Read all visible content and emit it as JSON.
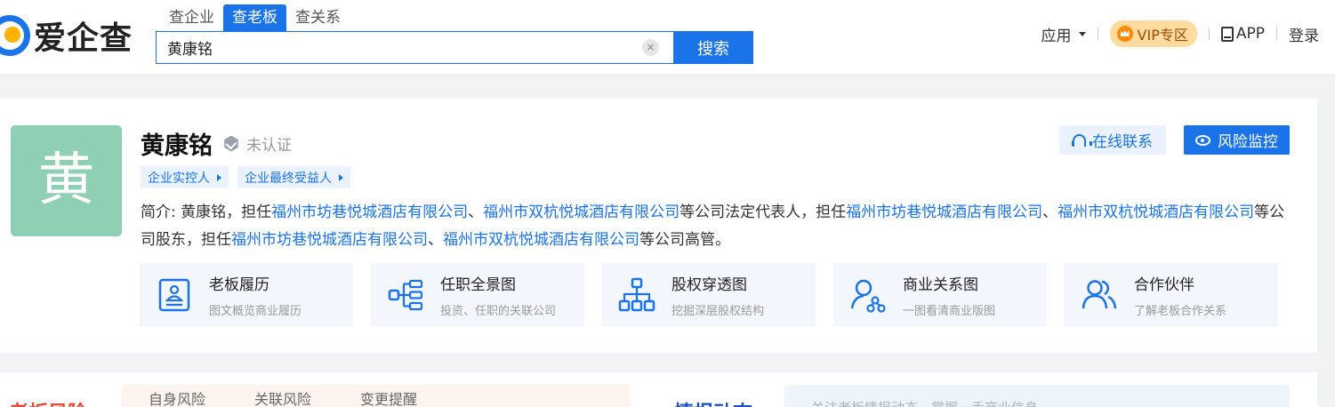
{
  "header": {
    "logo_text": "爱企查",
    "tabs": [
      {
        "label": "查企业",
        "active": false
      },
      {
        "label": "查老板",
        "active": true
      },
      {
        "label": "查关系",
        "active": false
      }
    ],
    "search_value": "黄康铭",
    "search_button": "搜索",
    "clear_glyph": "×",
    "nav": {
      "apps": "应用",
      "vip": "VIP专区",
      "app": "APP",
      "login": "登录"
    }
  },
  "profile": {
    "avatar_char": "黄",
    "name": "黄康铭",
    "verify_status": "未认证",
    "tags": [
      "企业实控人",
      "企业最终受益人"
    ],
    "contact_button": "在线联系",
    "monitor_button": "风险监控",
    "bio": {
      "prefix": "简介: ",
      "t1": "黄康铭，担任",
      "l1": "福州市坊巷悦城酒店有限公司",
      "s1": "、",
      "l2": "福州市双杭悦城酒店有限公司",
      "t2": "等公司法定代表人，担任",
      "l3": "福州市坊巷悦城酒店有限公司",
      "s2": "、",
      "l4": "福州市双杭悦城酒店有限公司",
      "t3": "等公司股东，担任",
      "l5": "福州市坊巷悦城酒店有限公司",
      "s3": "、",
      "l6": "福州市双杭悦城酒店有限公司",
      "t4": "等公司高管。"
    },
    "features": [
      {
        "title": "老板履历",
        "sub": "图文概览商业履历",
        "icon": "resume-icon"
      },
      {
        "title": "任职全景图",
        "sub": "投资、任职的关联公司",
        "icon": "tree-icon"
      },
      {
        "title": "股权穿透图",
        "sub": "挖掘深层股权结构",
        "icon": "org-chart-icon"
      },
      {
        "title": "商业关系图",
        "sub": "一图看清商业版图",
        "icon": "network-icon"
      },
      {
        "title": "合作伙伴",
        "sub": "了解老板合作关系",
        "icon": "partners-icon"
      }
    ]
  },
  "lower": {
    "risk_title": "老板风险",
    "risk_tabs": [
      "自身风险",
      "关联风险",
      "变更提醒"
    ],
    "intel_title": "情报动态",
    "intel_placeholder": "关注老板情报动态，掌握一手商业信息"
  },
  "colors": {
    "brand_blue": "#1a73e8",
    "avatar_green": "#8fd0b4",
    "risk_red": "#e84a3a",
    "vip_bg": "#ffdba0"
  }
}
